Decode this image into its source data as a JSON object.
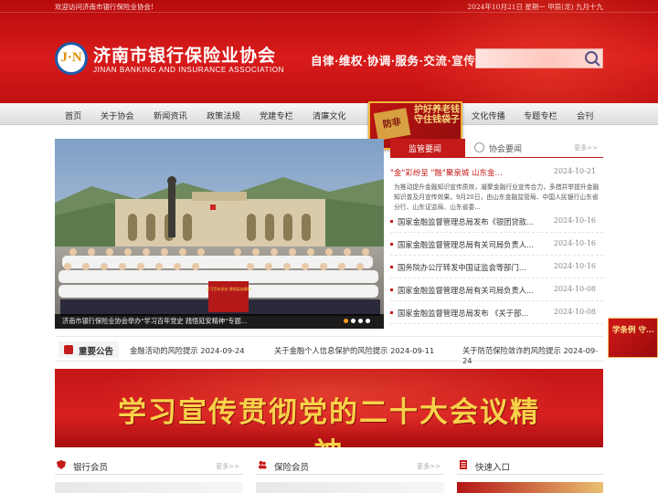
{
  "topbar": {
    "welcome": "欢迎访问济南市银行保险业协会!",
    "date": "2024年10月21日 星期一 甲辰(龙) 九月十九"
  },
  "logo": {
    "mark": "J·N",
    "cn": "济南市银行保险业协会",
    "en": "JINAN BANKING AND INSURANCE ASSOCIATION"
  },
  "slogan": "自律·维权·协调·服务·交流·宣传",
  "search": {
    "placeholder": "",
    "value": ""
  },
  "nav": [
    "首页",
    "关于协会",
    "新闻资讯",
    "政策法规",
    "党建专栏",
    "清廉文化",
    "文化传播",
    "专题专栏",
    "会刊"
  ],
  "promo": {
    "left": "防非",
    "right": "护好养老钱 守住钱袋子"
  },
  "slider": {
    "caption": "济南市银行保险业协会举办\"学习百年党史 践悟延安精神\"专题...",
    "banner_words": "学习百年党史 践悟延安精神",
    "dots": 4,
    "active_dot": 1
  },
  "news": {
    "tab_active": "监管要闻",
    "tab_inactive": "协会要闻",
    "more": "更多>>",
    "featured": {
      "title_pre": "\"金\"彩纷呈 \"融\"聚泉城 山东金...",
      "date": "2024-10-21",
      "body": "为推动提升金融知识宣传质效，凝聚金融行业宣传合力，多措并举提升金融知识普及月宣传效果，9月20日，由山东金融监管局、中国人民银行山东省分行、山东证监局、山东省委..."
    },
    "items": [
      {
        "title": "国家金融监督管理总局发布《银团贷款...",
        "date": "2024-10-16"
      },
      {
        "title": "国家金融监督管理总局有关司局负责人...",
        "date": "2024-10-16"
      },
      {
        "title": "国务院办公厅转发中国证监会等部门...",
        "date": "2024-10-16"
      },
      {
        "title": "国家金融监督管理总局有关司局负责人...",
        "date": "2024-10-08"
      },
      {
        "title": "国家金融监督管理总局发布 《关于部...",
        "date": "2024-10-08"
      }
    ]
  },
  "announcement": {
    "label": "重要公告",
    "items": [
      "金融活动的风险提示 2024-09-24",
      "关于金融个人信息保护的风险提示 2024-09-11",
      "关于防范保险敛诈的风险提示 2024-09-24"
    ]
  },
  "banner": {
    "text": "学习宣传贯彻党的二十大会议精神"
  },
  "sections": [
    {
      "title": "银行会员",
      "more": "更多>>"
    },
    {
      "title": "保险会员",
      "more": "更多>>"
    },
    {
      "title": "快速入口",
      "more": ""
    }
  ],
  "side_float": {
    "text": "学条例 守..."
  },
  "colors": {
    "brand_red": "#c51a1a",
    "gold": "#f7d24a",
    "dot_active": "#ff9b1b"
  }
}
